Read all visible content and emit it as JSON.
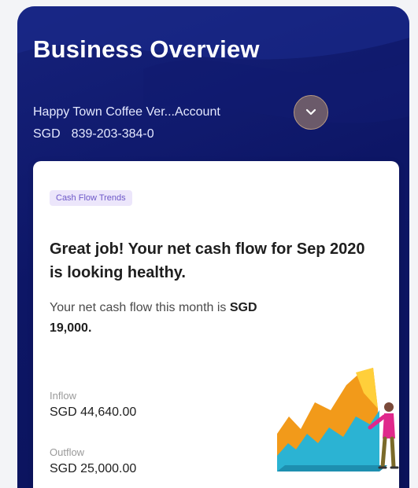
{
  "header": {
    "title": "Business Overview",
    "account_name": "Happy Town Coffee Ver...Account",
    "currency": "SGD",
    "account_number": "839-203-384-0",
    "dropdown_icon": "chevron-down-icon"
  },
  "card": {
    "tag": "Cash Flow Trends",
    "headline": "Great job! Your net cash flow for Sep 2020 is looking healthy.",
    "sub_prefix": "Your net cash flow this month is",
    "sub_amount": "SGD 19,000.",
    "inflow_label": "Inflow",
    "inflow_value": "SGD 44,640.00",
    "outflow_label": "Outflow",
    "outflow_value": "SGD 25,000.00",
    "illustration": "cash-flow-chart-illustration"
  },
  "colors": {
    "header_bg": "#0d1666",
    "tag_bg": "#ece6fb",
    "tag_text": "#6d58c8",
    "chart_orange": "#f29a1a",
    "chart_teal": "#2bb3d3"
  }
}
